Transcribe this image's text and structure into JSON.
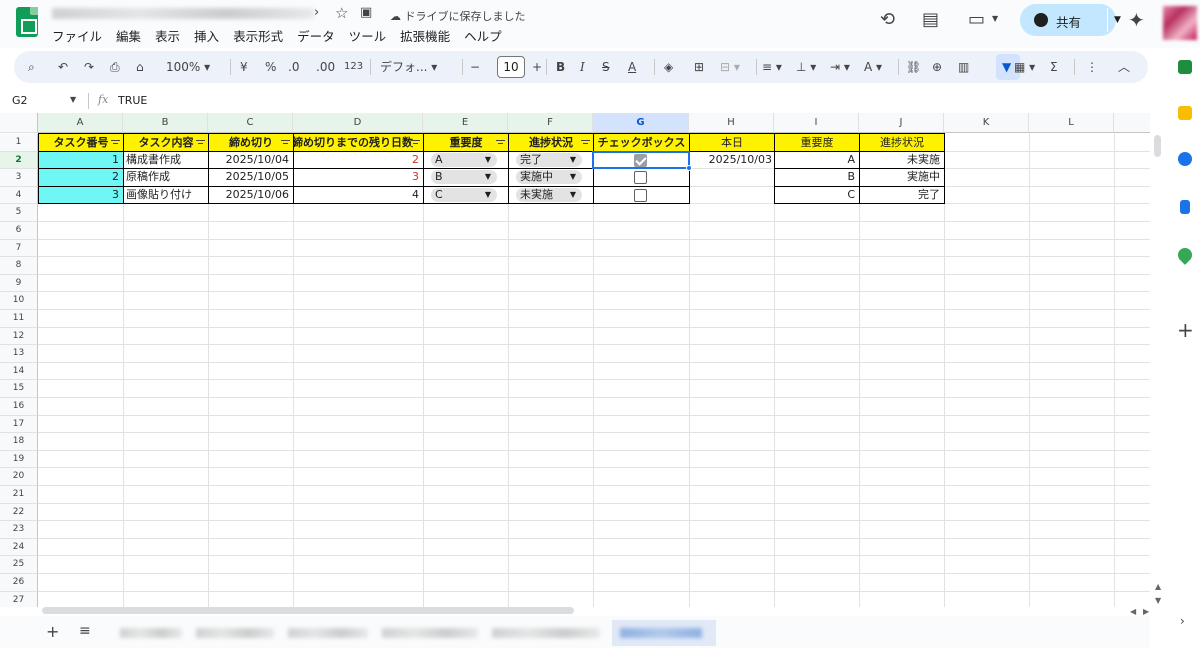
{
  "document": {
    "saved_status": "ドライブに保存しました"
  },
  "menu": [
    "ファイル",
    "編集",
    "表示",
    "挿入",
    "表示形式",
    "データ",
    "ツール",
    "拡張機能",
    "ヘルプ"
  ],
  "share": {
    "label": "共有"
  },
  "toolbar": {
    "zoom": "100%",
    "currency": "¥",
    "percent": "%",
    "dec_decrease": ".0",
    "dec_increase": ".00",
    "number_format": "123",
    "font": "デフォ...",
    "font_size": "10",
    "bold": "B",
    "italic": "I",
    "sum": "Σ"
  },
  "formula_bar": {
    "cell_ref": "G2",
    "fx": "fx",
    "value": "TRUE"
  },
  "grid": {
    "columns": [
      "A",
      "B",
      "C",
      "D",
      "E",
      "F",
      "G",
      "H",
      "I",
      "J",
      "K",
      "L"
    ],
    "rows": [
      "1",
      "2",
      "3",
      "4",
      "5",
      "6",
      "7",
      "8",
      "9",
      "10",
      "11",
      "12",
      "13",
      "14",
      "15",
      "16",
      "17",
      "18",
      "19",
      "20",
      "21",
      "22",
      "23",
      "24",
      "25",
      "26",
      "27"
    ],
    "headers": [
      "タスク番号",
      "タスク内容",
      "締め切り",
      "締め切りまでの残り日数",
      "重要度",
      "進捗状況",
      "チェックボックス",
      "本日",
      "重要度",
      "進捗状況"
    ],
    "tasks": [
      {
        "no": "1",
        "name": "構成書作成",
        "deadline": "2025/10/04",
        "remaining": "2",
        "remaining_red": true,
        "importance": "A",
        "status": "完了",
        "checked": true
      },
      {
        "no": "2",
        "name": "原稿作成",
        "deadline": "2025/10/05",
        "remaining": "3",
        "remaining_red": true,
        "importance": "B",
        "status": "実施中",
        "checked": false
      },
      {
        "no": "3",
        "name": "画像貼り付け",
        "deadline": "2025/10/06",
        "remaining": "4",
        "remaining_red": false,
        "importance": "C",
        "status": "未実施",
        "checked": false
      }
    ],
    "today": "2025/10/03",
    "importance_list": [
      "A",
      "B",
      "C"
    ],
    "status_list": [
      "未実施",
      "実施中",
      "完了"
    ]
  },
  "colors": {
    "header_yellow": "#fff200",
    "task_cyan": "#6ff7f5",
    "selection_blue": "#1a73e8",
    "red_text": "#d93025",
    "share_bg": "#c2e7ff"
  }
}
